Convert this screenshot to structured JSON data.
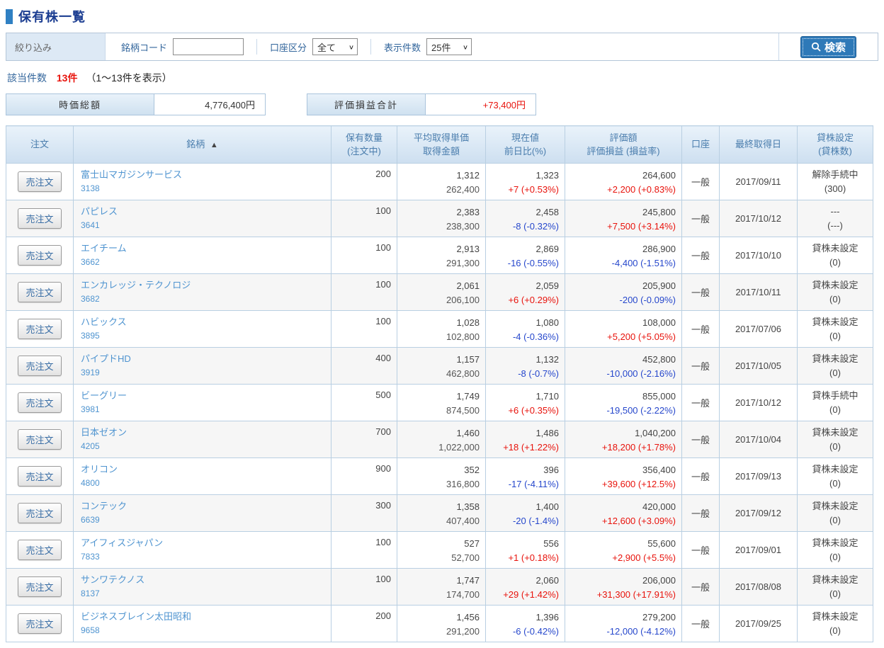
{
  "page": {
    "title": "保有株一覧"
  },
  "colors": {
    "accent_blue": "#2e79b8",
    "title_navy": "#1b3d91",
    "positive_red": "#e8130c",
    "negative_blue": "#2647cc",
    "link_blue": "#4f94d0",
    "header_blue_text": "#4a7dad"
  },
  "filter": {
    "label": "絞り込み",
    "code_label": "銘柄コード",
    "code_value": "",
    "account_label": "口座区分",
    "account_selected": "全て",
    "display_label": "表示件数",
    "display_selected": "25件",
    "search_label": "検索"
  },
  "result": {
    "label": "該当件数",
    "count": "13件",
    "range": "（1～13件を表示）"
  },
  "summary": {
    "market_value_label": "時価総額",
    "market_value": "4,776,400円",
    "pl_label": "評価損益合計",
    "pl_value": "+73,400円"
  },
  "table": {
    "headers": {
      "order": "注文",
      "name": "銘柄",
      "sort_icon": "▲",
      "qty_line1": "保有数量",
      "qty_line2": "(注文中)",
      "avg_line1": "平均取得単価",
      "avg_line2": "取得金額",
      "price_line1": "現在値",
      "price_line2": "前日比(%)",
      "value_line1": "評価額",
      "value_line2": "評価損益 (損益率)",
      "account": "口座",
      "date": "最終取得日",
      "lend_line1": "貸株設定",
      "lend_line2": "(貸株数)"
    },
    "rows": [
      {
        "order_label": "売注文",
        "name": "富士山マガジンサービス",
        "code": "3138",
        "quantity": "200",
        "avg_price": "1,312",
        "acq_amount": "262,400",
        "current_price": "1,323",
        "day_change": "+7 (+0.53%)",
        "day_change_dir": "up",
        "market_value": "264,600",
        "pl": "+2,200 (+0.83%)",
        "pl_dir": "up",
        "account": "一般",
        "last_date": "2017/09/11",
        "lending_status": "解除手続中",
        "lending_count": "(300)"
      },
      {
        "order_label": "売注文",
        "name": "パピレス",
        "code": "3641",
        "quantity": "100",
        "avg_price": "2,383",
        "acq_amount": "238,300",
        "current_price": "2,458",
        "day_change": "-8 (-0.32%)",
        "day_change_dir": "down",
        "market_value": "245,800",
        "pl": "+7,500 (+3.14%)",
        "pl_dir": "up",
        "account": "一般",
        "last_date": "2017/10/12",
        "lending_status": "---",
        "lending_count": "(---)"
      },
      {
        "order_label": "売注文",
        "name": "エイチーム",
        "code": "3662",
        "quantity": "100",
        "avg_price": "2,913",
        "acq_amount": "291,300",
        "current_price": "2,869",
        "day_change": "-16 (-0.55%)",
        "day_change_dir": "down",
        "market_value": "286,900",
        "pl": "-4,400 (-1.51%)",
        "pl_dir": "down",
        "account": "一般",
        "last_date": "2017/10/10",
        "lending_status": "貸株未設定",
        "lending_count": "(0)"
      },
      {
        "order_label": "売注文",
        "name": "エンカレッジ・テクノロジ",
        "code": "3682",
        "quantity": "100",
        "avg_price": "2,061",
        "acq_amount": "206,100",
        "current_price": "2,059",
        "day_change": "+6 (+0.29%)",
        "day_change_dir": "up",
        "market_value": "205,900",
        "pl": "-200 (-0.09%)",
        "pl_dir": "down",
        "account": "一般",
        "last_date": "2017/10/11",
        "lending_status": "貸株未設定",
        "lending_count": "(0)"
      },
      {
        "order_label": "売注文",
        "name": "ハビックス",
        "code": "3895",
        "quantity": "100",
        "avg_price": "1,028",
        "acq_amount": "102,800",
        "current_price": "1,080",
        "day_change": "-4 (-0.36%)",
        "day_change_dir": "down",
        "market_value": "108,000",
        "pl": "+5,200 (+5.05%)",
        "pl_dir": "up",
        "account": "一般",
        "last_date": "2017/07/06",
        "lending_status": "貸株未設定",
        "lending_count": "(0)"
      },
      {
        "order_label": "売注文",
        "name": "パイプドHD",
        "code": "3919",
        "quantity": "400",
        "avg_price": "1,157",
        "acq_amount": "462,800",
        "current_price": "1,132",
        "day_change": "-8 (-0.7%)",
        "day_change_dir": "down",
        "market_value": "452,800",
        "pl": "-10,000 (-2.16%)",
        "pl_dir": "down",
        "account": "一般",
        "last_date": "2017/10/05",
        "lending_status": "貸株未設定",
        "lending_count": "(0)"
      },
      {
        "order_label": "売注文",
        "name": "ビーグリー",
        "code": "3981",
        "quantity": "500",
        "avg_price": "1,749",
        "acq_amount": "874,500",
        "current_price": "1,710",
        "day_change": "+6 (+0.35%)",
        "day_change_dir": "up",
        "market_value": "855,000",
        "pl": "-19,500 (-2.22%)",
        "pl_dir": "down",
        "account": "一般",
        "last_date": "2017/10/12",
        "lending_status": "貸株手続中",
        "lending_count": "(0)"
      },
      {
        "order_label": "売注文",
        "name": "日本ゼオン",
        "code": "4205",
        "quantity": "700",
        "avg_price": "1,460",
        "acq_amount": "1,022,000",
        "current_price": "1,486",
        "day_change": "+18 (+1.22%)",
        "day_change_dir": "up",
        "market_value": "1,040,200",
        "pl": "+18,200 (+1.78%)",
        "pl_dir": "up",
        "account": "一般",
        "last_date": "2017/10/04",
        "lending_status": "貸株未設定",
        "lending_count": "(0)"
      },
      {
        "order_label": "売注文",
        "name": "オリコン",
        "code": "4800",
        "quantity": "900",
        "avg_price": "352",
        "acq_amount": "316,800",
        "current_price": "396",
        "day_change": "-17 (-4.11%)",
        "day_change_dir": "down",
        "market_value": "356,400",
        "pl": "+39,600 (+12.5%)",
        "pl_dir": "up",
        "account": "一般",
        "last_date": "2017/09/13",
        "lending_status": "貸株未設定",
        "lending_count": "(0)"
      },
      {
        "order_label": "売注文",
        "name": "コンテック",
        "code": "6639",
        "quantity": "300",
        "avg_price": "1,358",
        "acq_amount": "407,400",
        "current_price": "1,400",
        "day_change": "-20 (-1.4%)",
        "day_change_dir": "down",
        "market_value": "420,000",
        "pl": "+12,600 (+3.09%)",
        "pl_dir": "up",
        "account": "一般",
        "last_date": "2017/09/12",
        "lending_status": "貸株未設定",
        "lending_count": "(0)"
      },
      {
        "order_label": "売注文",
        "name": "アイフィスジャパン",
        "code": "7833",
        "quantity": "100",
        "avg_price": "527",
        "acq_amount": "52,700",
        "current_price": "556",
        "day_change": "+1 (+0.18%)",
        "day_change_dir": "up",
        "market_value": "55,600",
        "pl": "+2,900 (+5.5%)",
        "pl_dir": "up",
        "account": "一般",
        "last_date": "2017/09/01",
        "lending_status": "貸株未設定",
        "lending_count": "(0)"
      },
      {
        "order_label": "売注文",
        "name": "サンワテクノス",
        "code": "8137",
        "quantity": "100",
        "avg_price": "1,747",
        "acq_amount": "174,700",
        "current_price": "2,060",
        "day_change": "+29 (+1.42%)",
        "day_change_dir": "up",
        "market_value": "206,000",
        "pl": "+31,300 (+17.91%)",
        "pl_dir": "up",
        "account": "一般",
        "last_date": "2017/08/08",
        "lending_status": "貸株未設定",
        "lending_count": "(0)"
      },
      {
        "order_label": "売注文",
        "name": "ビジネスブレイン太田昭和",
        "code": "9658",
        "quantity": "200",
        "avg_price": "1,456",
        "acq_amount": "291,200",
        "current_price": "1,396",
        "day_change": "-6 (-0.42%)",
        "day_change_dir": "down",
        "market_value": "279,200",
        "pl": "-12,000 (-4.12%)",
        "pl_dir": "down",
        "account": "一般",
        "last_date": "2017/09/25",
        "lending_status": "貸株未設定",
        "lending_count": "(0)"
      }
    ]
  }
}
